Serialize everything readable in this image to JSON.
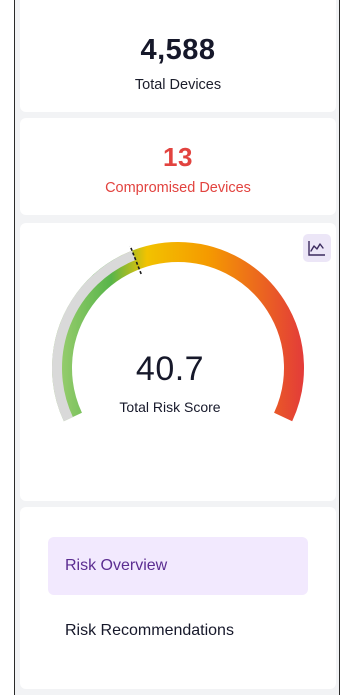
{
  "summary": {
    "total_devices": {
      "value": "4,588",
      "label": "Total Devices"
    },
    "compromised_devices": {
      "value": "13",
      "label": "Compromised Devices"
    }
  },
  "risk": {
    "score": "40.7",
    "score_numeric": 40.7,
    "label": "Total Risk Score",
    "trend_icon": "line-chart-icon"
  },
  "menu": {
    "items": [
      {
        "label": "Risk Overview",
        "active": true
      },
      {
        "label": "Risk Recommendations",
        "active": false
      }
    ]
  },
  "colors": {
    "danger": "#e2433f",
    "accent": "#5b2d91",
    "accent_bg": "#f2e9fe",
    "gauge_green": "#58b54a",
    "gauge_yellow": "#f2c200",
    "gauge_orange": "#f59a00",
    "gauge_red": "#e33a3a"
  }
}
